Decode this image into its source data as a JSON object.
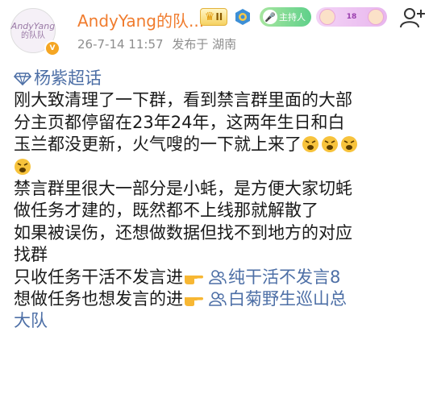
{
  "header": {
    "avatar_text_line1": "AndyYang",
    "avatar_text_line2": "的队队",
    "username": "AndyYang的队...",
    "crown_badge": "II",
    "host_badge": "主持人",
    "level_badge": "18",
    "date": "26-7-14 11:57",
    "posted_from": "发布于 湖南"
  },
  "post": {
    "topic": "杨紫超话",
    "paragraph1_lines": [
      "刚大致清理了一下群，看到禁言群里面的大部",
      "分主页都停留在23年24年，这两年生日和白",
      "玉兰都没更新，火气嗖的一下就上来了"
    ],
    "paragraph2_lines": [
      "禁言群里很大一部分是小蚝，是方便大家切蚝",
      "做任务才建的，既然都不上线那就解散了",
      "如果被误伤，还想做数据但找不到地方的对应",
      "找群"
    ],
    "line_work_only": "只收任务干活不发言进",
    "link_work_only": "纯干活不发言8",
    "line_work_and_talk": "想做任务也想发言的进",
    "link_work_and_talk_1": "白菊野生巡山总",
    "link_work_and_talk_2": "大队"
  },
  "colors": {
    "username": "#f07c2e",
    "link": "#4d6fa6",
    "meta": "#8e8e8e"
  },
  "icons": [
    "verified-v-icon",
    "crown-badge-icon",
    "medal-icon",
    "host-badge-icon",
    "level-badge-icon",
    "follow-add-icon",
    "super-topic-diamond-icon",
    "angry-face-emoji",
    "pointing-hand-emoji",
    "group-chat-icon"
  ]
}
